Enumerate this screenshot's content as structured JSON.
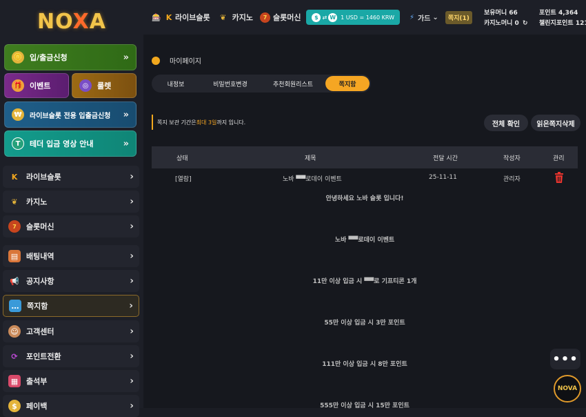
{
  "brand": {
    "logo_text_a": "NO",
    "logo_text_x": "X",
    "logo_text_b": "A"
  },
  "sidebar": {
    "promos": [
      {
        "label": "입/출금신청",
        "icon": "coin-stack-icon",
        "arrow": "»"
      },
      {
        "label": "이벤트",
        "icon": "gift-icon"
      },
      {
        "label": "룰렛",
        "icon": "roulette-icon"
      },
      {
        "label": "라이브슬롯 전용 입출금신청",
        "icon": "coins-person-icon",
        "arrow": "»"
      },
      {
        "label": "테더 입금 영상 안내",
        "icon": "tether-icon",
        "arrow": "»"
      }
    ],
    "items": [
      {
        "label": "라이브슬롯",
        "icon": "live-slot-icon"
      },
      {
        "label": "카지노",
        "icon": "casino-wreath-icon"
      },
      {
        "label": "슬롯머신",
        "icon": "slot-machine-icon"
      },
      {
        "label": "배팅내역",
        "icon": "clipboard-icon"
      },
      {
        "label": "공지사항",
        "icon": "megaphone-icon"
      },
      {
        "label": "쪽지함",
        "icon": "message-icon"
      },
      {
        "label": "고객센터",
        "icon": "support-agent-icon"
      },
      {
        "label": "포인트전환",
        "icon": "exchange-icon"
      },
      {
        "label": "출석부",
        "icon": "calendar-icon"
      },
      {
        "label": "페이백",
        "icon": "payback-icon"
      }
    ],
    "active_index": 5
  },
  "topbar": {
    "nav": [
      {
        "label": "라이브슬롯",
        "icon": "live-slot-icon"
      },
      {
        "label": "카지노",
        "icon": "casino-wreath-icon"
      },
      {
        "label": "슬롯머신",
        "icon": "slot-machine-icon"
      }
    ],
    "rate": "1 USD = 1460 KRW",
    "guide": "가드",
    "messages": "쪽지(1)",
    "wallet_money": "보유머니 66",
    "casino_money": "카지노머니 0",
    "points": "포인트 4,364",
    "challenge_points": "챌린지포인트 121"
  },
  "page": {
    "title": "마이페이지",
    "tabs": [
      "내정보",
      "비밀번호변경",
      "추천회원리스트",
      "쪽지함"
    ],
    "active_tab": 3,
    "notice_prefix": "쪽지 보관 기간은",
    "notice_highlight": "최대 3일",
    "notice_suffix": "까지 입니다.",
    "btn_read_all": "전체 확인",
    "btn_delete_read": "읽은쪽지삭제"
  },
  "table": {
    "headers": [
      "상태",
      "제목",
      "전달 시간",
      "작성자",
      "관리"
    ],
    "rows": [
      {
        "status": "[열람]",
        "title": "노바 ▀▀로데이 이벤트",
        "date": "25-11-11",
        "author": "관리자"
      }
    ],
    "content_lines": [
      "안녕하세요 노바 슬롯 입니다!",
      "노바 ▀▀로데이 이벤트",
      "11만 이상 입금 시 ▀▀로 기프티콘 1개",
      "55만 이상 입금 시 3만 포인트",
      "111만 이상 입금 시 8만 포인트",
      "555만 이상 입금 시 15만 포인트"
    ]
  },
  "fab": {
    "more": "•••",
    "logo": "NOVA"
  }
}
